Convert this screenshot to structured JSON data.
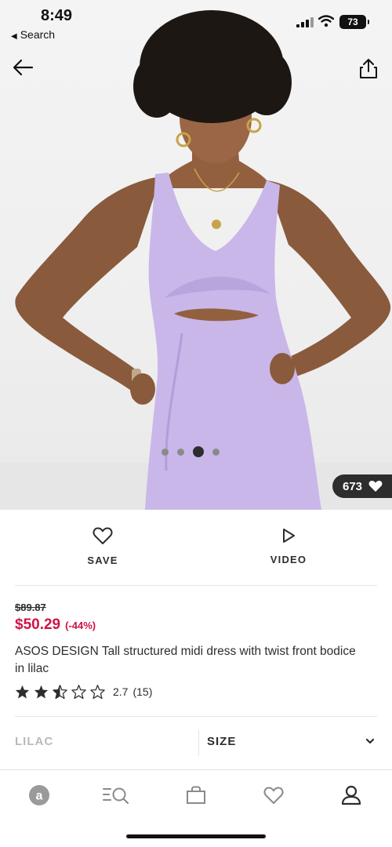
{
  "status_bar": {
    "time": "8:49",
    "back_app": "Search",
    "battery": "73"
  },
  "gallery": {
    "image_count": 4,
    "active_index": 2,
    "likes": "673"
  },
  "actions": {
    "save_label": "SAVE",
    "video_label": "VIDEO"
  },
  "product": {
    "old_price": "$89.87",
    "price": "$50.29",
    "discount": "(-44%)",
    "title": "ASOS DESIGN Tall structured midi dress with twist front bodice in lilac",
    "rating_value": "2.7",
    "rating_count": "(15)",
    "stars": 2.5
  },
  "variants": {
    "color": "LILAC",
    "size_label": "SIZE"
  },
  "colors": {
    "price_red": "#d01345",
    "dark": "#2d2d2d",
    "muted": "#b9b9b9",
    "dress_lilac": "#c9b7ea"
  },
  "tabs": [
    "home-icon",
    "search-menu-icon",
    "bag-icon",
    "heart-icon",
    "account-icon"
  ]
}
